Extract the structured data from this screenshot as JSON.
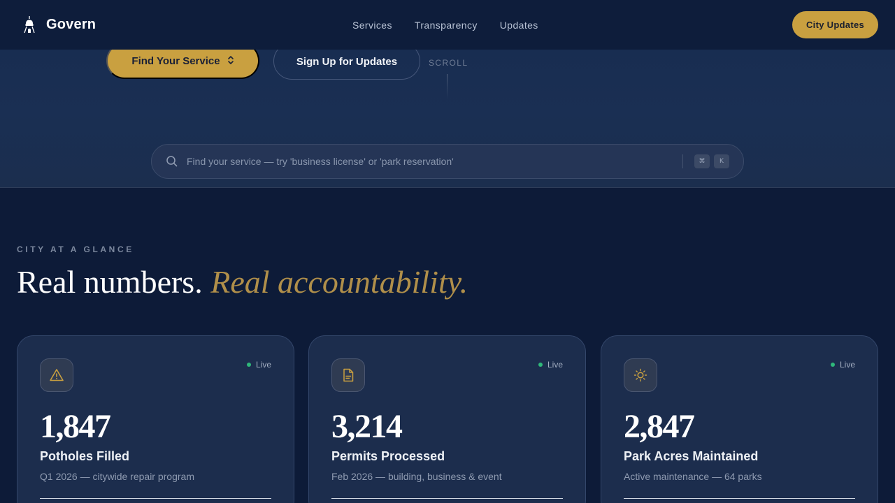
{
  "nav": {
    "brand": "Govern",
    "links": [
      "Services",
      "Transparency",
      "Updates"
    ],
    "cta": "City Updates"
  },
  "hero": {
    "find_button": "Find Your Service",
    "signup_button": "Sign Up for Updates",
    "scroll_label": "SCROLL"
  },
  "search": {
    "placeholder": "Find your service — try 'business license' or 'park reservation'",
    "shortcut_keys": [
      "⌘",
      "K"
    ]
  },
  "glance": {
    "eyebrow": "CITY AT A GLANCE",
    "headline_main": "Real numbers.",
    "headline_accent": "Real accountability."
  },
  "cards": [
    {
      "icon": "warning-icon",
      "status": "Live",
      "value": "1,847",
      "label": "Potholes Filled",
      "sub": "Q1 2026 — citywide repair program"
    },
    {
      "icon": "document-icon",
      "status": "Live",
      "value": "3,214",
      "label": "Permits Processed",
      "sub": "Feb 2026 — building, business & event"
    },
    {
      "icon": "sun-icon",
      "status": "Live",
      "value": "2,847",
      "label": "Park Acres Maintained",
      "sub": "Active maintenance — 64 parks"
    }
  ],
  "colors": {
    "accent_gold": "#c9a040",
    "live_green": "#2fb87a",
    "background": "#0d1b38"
  }
}
